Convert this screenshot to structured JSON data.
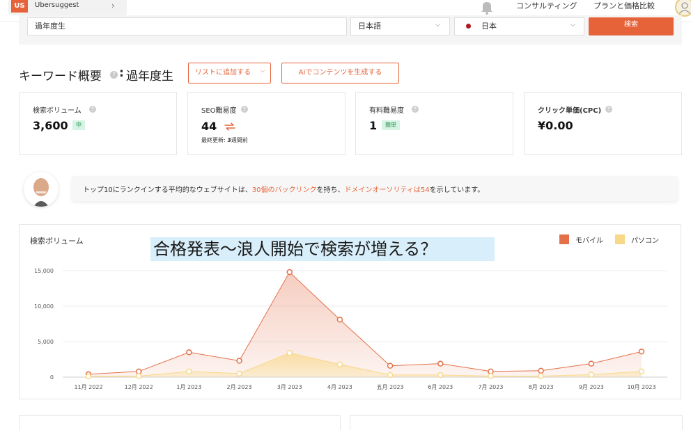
{
  "topbar": {
    "app_abbr": "US",
    "app_name": "Ubersuggest",
    "nav_consulting": "コンサルティング",
    "nav_plans": "プランと価格比較"
  },
  "search": {
    "keyword": "過年度生",
    "language": "日本語",
    "location": "日本",
    "button": "検索"
  },
  "overview": {
    "title": "キーワード概要",
    "colon": ":",
    "keyword": "過年度生",
    "add_to_list": "リストに追加する",
    "ai_button": "AIでコンテンツを生成する"
  },
  "metrics": {
    "volume": {
      "label": "検索ボリューム",
      "value": "3,600",
      "badge": "中"
    },
    "seo": {
      "label": "SEO難易度",
      "value": "44",
      "updated_prefix": "最終更新: ",
      "updated_num": "3",
      "updated_suffix": "週間前"
    },
    "paid": {
      "label": "有料難易度",
      "value": "1",
      "badge": "簡単"
    },
    "cpc": {
      "label": "クリック単価(CPC)",
      "value": "¥0.00"
    }
  },
  "tip": {
    "part1": "トップ10にランクインする平均的なウェブサイトは、",
    "link1": "30個のバックリンク",
    "part2": "を持ち、",
    "link2": "ドメインオーソリティは54",
    "part3": "を示しています。"
  },
  "chart_panel": {
    "title": "検索ボリューム",
    "overlay_note": "合格発表〜浪人開始で検索が増える？"
  },
  "colors": {
    "accent": "#e6633a",
    "mobile": "#e4704a",
    "desktop": "#f8d98a",
    "badge_bg": "#d7f3e3",
    "badge_text": "#1d8c4c"
  },
  "chart_data": {
    "type": "area",
    "x": [
      "11月 2022",
      "12月 2022",
      "1月 2023",
      "2月 2023",
      "3月 2023",
      "4月 2023",
      "五月 2023",
      "6月 2023",
      "7月 2023",
      "8月 2023",
      "9月 2023",
      "10月 2023"
    ],
    "y_ticks": [
      "0",
      "5,000",
      "10,000",
      "15,000"
    ],
    "ylim": [
      0,
      15000
    ],
    "grid": true,
    "legend_position": "top-right",
    "series": [
      {
        "name": "モバイル",
        "color": "#e4704a",
        "values": [
          400,
          800,
          3500,
          2300,
          14800,
          8100,
          1600,
          1900,
          800,
          900,
          1900,
          3600
        ]
      },
      {
        "name": "パソコン",
        "color": "#f8d98a",
        "values": [
          100,
          150,
          800,
          500,
          3400,
          1800,
          300,
          300,
          150,
          150,
          350,
          800
        ]
      }
    ]
  }
}
